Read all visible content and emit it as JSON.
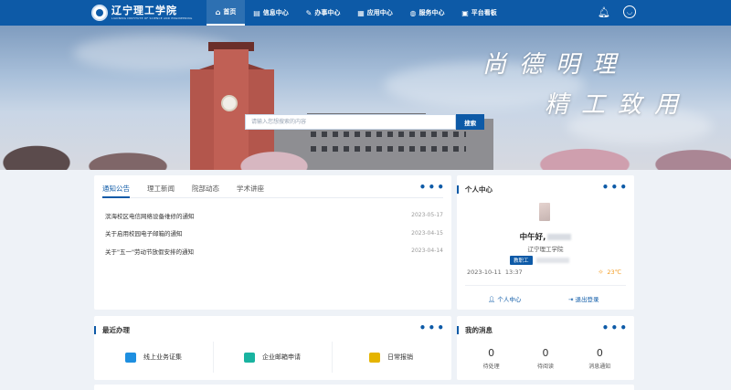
{
  "logo": {
    "name": "辽宁理工学院",
    "english": "LIAONING INSTITUTE OF SCIENCE AND ENGINEERING"
  },
  "nav": {
    "items": [
      {
        "label": "首页",
        "icon": "home-icon",
        "active": true
      },
      {
        "label": "信息中心",
        "icon": "info-icon"
      },
      {
        "label": "办事中心",
        "icon": "affairs-icon"
      },
      {
        "label": "应用中心",
        "icon": "apps-icon"
      },
      {
        "label": "服务中心",
        "icon": "service-icon"
      },
      {
        "label": "平台看板",
        "icon": "dashboard-icon"
      }
    ],
    "right_icons": [
      "bell-icon",
      "user-circle-icon"
    ]
  },
  "banner": {
    "slogan_line1": "尚德明理",
    "slogan_line2": "精工致用",
    "search_placeholder": "请输入您想搜索的内容",
    "search_button": "搜索"
  },
  "news": {
    "tabs": [
      "通知公告",
      "理工新闻",
      "院部动态",
      "学术讲座"
    ],
    "active_tab": 0,
    "items": [
      {
        "title": "滨海校区电信网络设备维修的通知",
        "date": "2023-05-17"
      },
      {
        "title": "关于启用校园电子邮箱的通知",
        "date": "2023-04-15"
      },
      {
        "title": "关于\"五一\"劳动节放假安排的通知",
        "date": "2023-04-14"
      }
    ]
  },
  "user_center": {
    "title": "个人中心",
    "greeting": "中午好,",
    "school": "辽宁理工学院",
    "role": "教职工",
    "date": "2023-10-11",
    "time": "13:37",
    "temperature": "23℃",
    "link_profile": "个人中心",
    "link_logout": "退出登录"
  },
  "recent": {
    "title": "最近办理",
    "apps": [
      {
        "label": "线上业务证集",
        "color": "#1e8fe0"
      },
      {
        "label": "企业邮箱申请",
        "color": "#19b3a0"
      },
      {
        "label": "日常报销",
        "color": "#e5b400"
      }
    ]
  },
  "messages": {
    "title": "我的消息",
    "items": [
      {
        "count": "0",
        "label": "待处理"
      },
      {
        "count": "0",
        "label": "待阅读"
      },
      {
        "count": "0",
        "label": "消息通知"
      }
    ]
  },
  "colors": {
    "primary": "#0d5aa7",
    "warning": "#f39a1e"
  }
}
